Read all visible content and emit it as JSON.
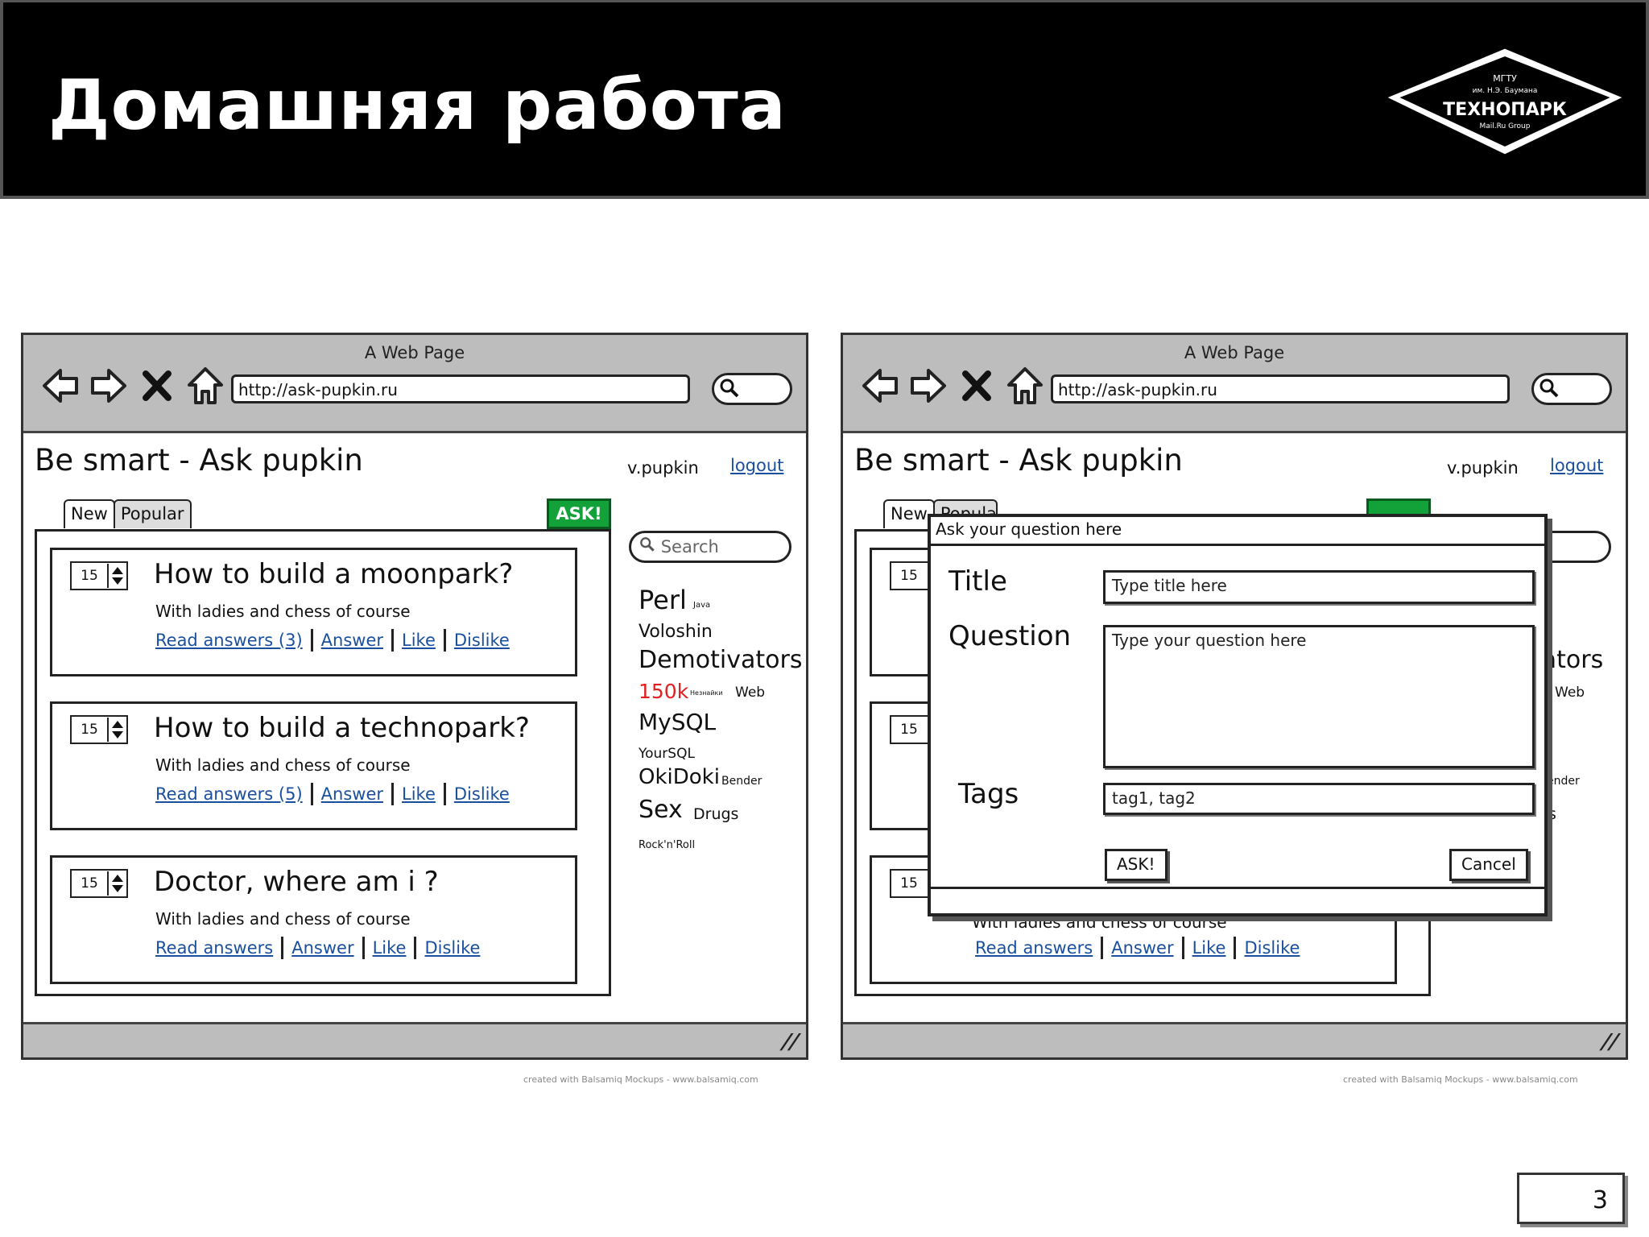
{
  "slide": {
    "title": "Домашняя работа",
    "page_number": "3"
  },
  "logo": {
    "line1": "МГТУ",
    "line2": "им. Н.Э. Баумана",
    "name": "ТЕХНОПАРК",
    "line3": "Mail.Ru Group"
  },
  "browser": {
    "window_title": "A Web Page",
    "url": "http://ask-pupkin.ru"
  },
  "site": {
    "title": "Be smart - Ask pupkin",
    "username": "v.pupkin",
    "logout": "logout",
    "tabs": [
      "New",
      "Popular"
    ],
    "ask_button": "ASK!",
    "search_placeholder": "Search"
  },
  "questions": [
    {
      "votes": "15",
      "title": "How to build a moonpark?",
      "subtitle": "With ladies and chess of course",
      "links": [
        "Read answers (3)",
        "Answer",
        "Like",
        "Dislike"
      ]
    },
    {
      "votes": "15",
      "title": "How to build a technopark?",
      "subtitle": "With ladies and chess of course",
      "links": [
        "Read answers (5)",
        "Answer",
        "Like",
        "Dislike"
      ]
    },
    {
      "votes": "15",
      "title": "Doctor, where am i ?",
      "subtitle": "With ladies and chess of course",
      "links": [
        "Read answers",
        "Answer",
        "Like",
        "Dislike"
      ]
    }
  ],
  "tag_cloud": [
    {
      "text": "Perl"
    },
    {
      "text": "Java"
    },
    {
      "text": "Voloshin"
    },
    {
      "text": "Demotivators"
    },
    {
      "text": "150k",
      "color": "#e02020"
    },
    {
      "text": "Незнайки"
    },
    {
      "text": "Web"
    },
    {
      "text": "MySQL"
    },
    {
      "text": "YourSQL"
    },
    {
      "text": "OkiDoki"
    },
    {
      "text": "Bender"
    },
    {
      "text": "Sex"
    },
    {
      "text": "Drugs"
    },
    {
      "text": "Rock'n'Roll"
    }
  ],
  "modal": {
    "header": "Ask your question here",
    "title_label": "Title",
    "title_placeholder": "Type title here",
    "question_label": "Question",
    "question_placeholder": "Type your question here",
    "tags_label": "Tags",
    "tags_value": "tag1, tag2",
    "ask_button": "ASK!",
    "cancel_button": "Cancel"
  },
  "partial": {
    "tab_popular_clip": "Popular",
    "demotivators_clip": "vators",
    "web_clip": "Web",
    "bender_clip": "ender",
    "drugs_clip": "s",
    "covered_subtitle": "With ladies and chess of course"
  },
  "credit": "created with Balsamiq Mockups - www.balsamiq.com",
  "colors": {
    "link": "#1a4f9e",
    "ask_green": "#13a13a",
    "chrome_gray": "#bdbdbd",
    "tag_red": "#e02020"
  }
}
